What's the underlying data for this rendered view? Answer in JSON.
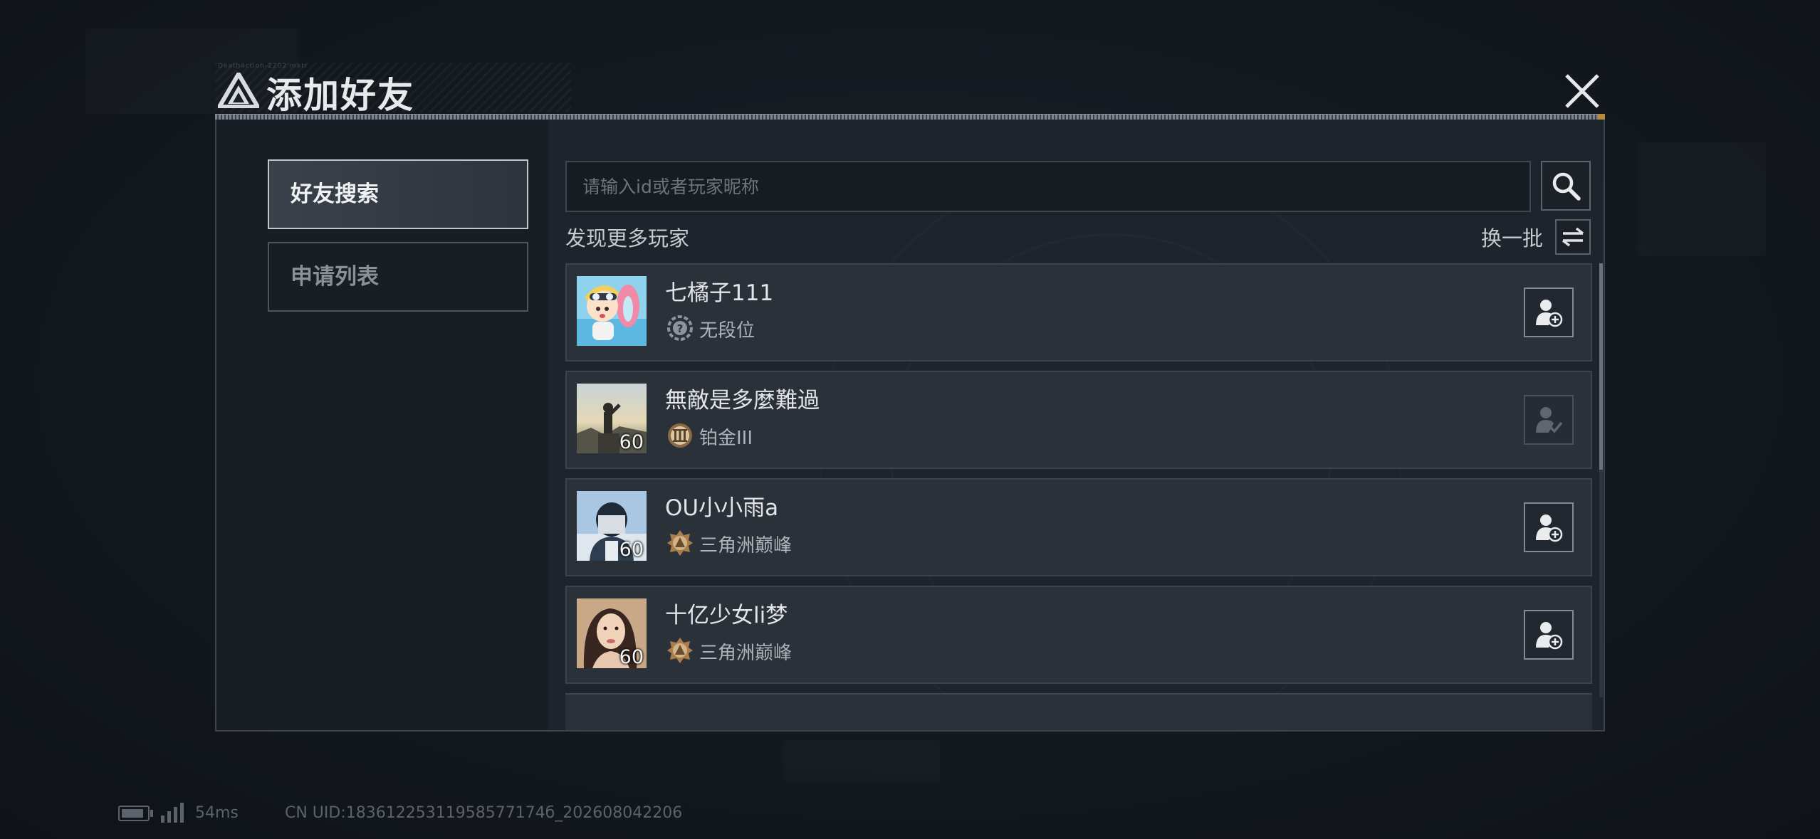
{
  "header": {
    "title": "添加好友",
    "tiny_text": "Deathaction-2202 matr"
  },
  "sidebar": {
    "tabs": [
      {
        "label": "好友搜索",
        "active": true
      },
      {
        "label": "申请列表",
        "active": false
      }
    ]
  },
  "search": {
    "placeholder": "请输入id或者玩家昵称"
  },
  "discover": {
    "label": "发现更多玩家",
    "refresh_label": "换一批"
  },
  "players": [
    {
      "name": "七橘子111",
      "rank": "无段位",
      "level": "",
      "add_enabled": true
    },
    {
      "name": "無敵是多麼難過",
      "rank": "铂金III",
      "level": "60",
      "add_enabled": false
    },
    {
      "name": "OU小小雨a",
      "rank": "三角洲巅峰",
      "level": "60",
      "add_enabled": true
    },
    {
      "name": "十亿少女li梦",
      "rank": "三角洲巅峰",
      "level": "60",
      "add_enabled": true
    }
  ],
  "status": {
    "ping": "54ms",
    "uid": "CN UID:18361225311958577174б_202608042206"
  },
  "colors": {
    "accent": "#b68a3c",
    "panel": "#1d232b",
    "row": "#2b3139"
  }
}
